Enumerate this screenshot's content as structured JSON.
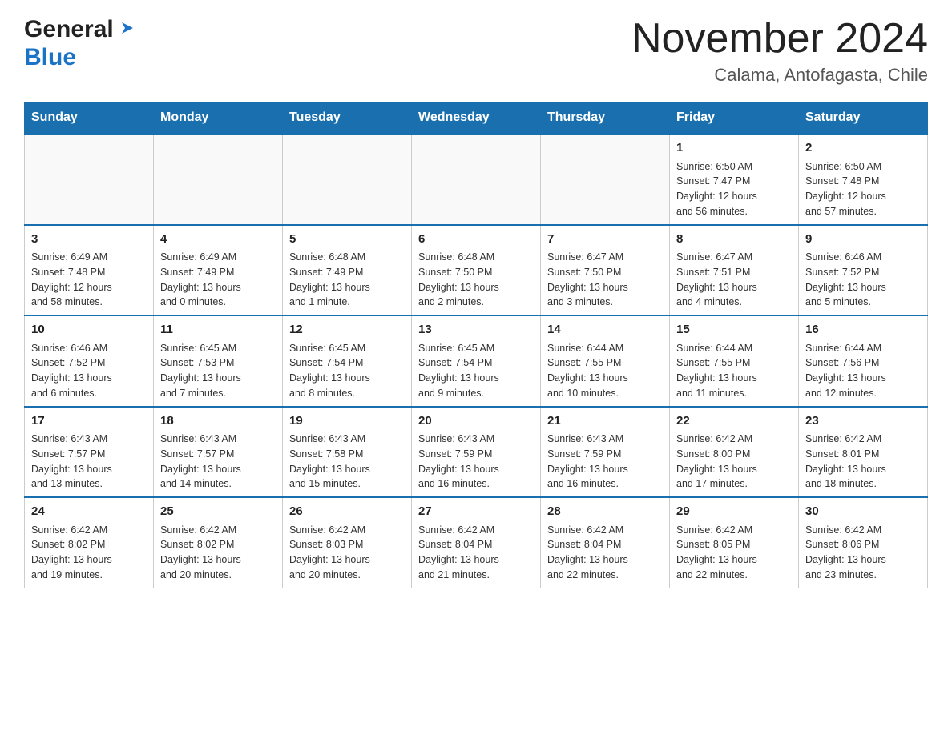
{
  "header": {
    "logo": {
      "general_text": "General",
      "blue_text": "Blue"
    },
    "month_title": "November 2024",
    "location": "Calama, Antofagasta, Chile"
  },
  "weekdays": [
    "Sunday",
    "Monday",
    "Tuesday",
    "Wednesday",
    "Thursday",
    "Friday",
    "Saturday"
  ],
  "weeks": [
    {
      "days": [
        {
          "number": "",
          "info": ""
        },
        {
          "number": "",
          "info": ""
        },
        {
          "number": "",
          "info": ""
        },
        {
          "number": "",
          "info": ""
        },
        {
          "number": "",
          "info": ""
        },
        {
          "number": "1",
          "info": "Sunrise: 6:50 AM\nSunset: 7:47 PM\nDaylight: 12 hours\nand 56 minutes."
        },
        {
          "number": "2",
          "info": "Sunrise: 6:50 AM\nSunset: 7:48 PM\nDaylight: 12 hours\nand 57 minutes."
        }
      ]
    },
    {
      "days": [
        {
          "number": "3",
          "info": "Sunrise: 6:49 AM\nSunset: 7:48 PM\nDaylight: 12 hours\nand 58 minutes."
        },
        {
          "number": "4",
          "info": "Sunrise: 6:49 AM\nSunset: 7:49 PM\nDaylight: 13 hours\nand 0 minutes."
        },
        {
          "number": "5",
          "info": "Sunrise: 6:48 AM\nSunset: 7:49 PM\nDaylight: 13 hours\nand 1 minute."
        },
        {
          "number": "6",
          "info": "Sunrise: 6:48 AM\nSunset: 7:50 PM\nDaylight: 13 hours\nand 2 minutes."
        },
        {
          "number": "7",
          "info": "Sunrise: 6:47 AM\nSunset: 7:50 PM\nDaylight: 13 hours\nand 3 minutes."
        },
        {
          "number": "8",
          "info": "Sunrise: 6:47 AM\nSunset: 7:51 PM\nDaylight: 13 hours\nand 4 minutes."
        },
        {
          "number": "9",
          "info": "Sunrise: 6:46 AM\nSunset: 7:52 PM\nDaylight: 13 hours\nand 5 minutes."
        }
      ]
    },
    {
      "days": [
        {
          "number": "10",
          "info": "Sunrise: 6:46 AM\nSunset: 7:52 PM\nDaylight: 13 hours\nand 6 minutes."
        },
        {
          "number": "11",
          "info": "Sunrise: 6:45 AM\nSunset: 7:53 PM\nDaylight: 13 hours\nand 7 minutes."
        },
        {
          "number": "12",
          "info": "Sunrise: 6:45 AM\nSunset: 7:54 PM\nDaylight: 13 hours\nand 8 minutes."
        },
        {
          "number": "13",
          "info": "Sunrise: 6:45 AM\nSunset: 7:54 PM\nDaylight: 13 hours\nand 9 minutes."
        },
        {
          "number": "14",
          "info": "Sunrise: 6:44 AM\nSunset: 7:55 PM\nDaylight: 13 hours\nand 10 minutes."
        },
        {
          "number": "15",
          "info": "Sunrise: 6:44 AM\nSunset: 7:55 PM\nDaylight: 13 hours\nand 11 minutes."
        },
        {
          "number": "16",
          "info": "Sunrise: 6:44 AM\nSunset: 7:56 PM\nDaylight: 13 hours\nand 12 minutes."
        }
      ]
    },
    {
      "days": [
        {
          "number": "17",
          "info": "Sunrise: 6:43 AM\nSunset: 7:57 PM\nDaylight: 13 hours\nand 13 minutes."
        },
        {
          "number": "18",
          "info": "Sunrise: 6:43 AM\nSunset: 7:57 PM\nDaylight: 13 hours\nand 14 minutes."
        },
        {
          "number": "19",
          "info": "Sunrise: 6:43 AM\nSunset: 7:58 PM\nDaylight: 13 hours\nand 15 minutes."
        },
        {
          "number": "20",
          "info": "Sunrise: 6:43 AM\nSunset: 7:59 PM\nDaylight: 13 hours\nand 16 minutes."
        },
        {
          "number": "21",
          "info": "Sunrise: 6:43 AM\nSunset: 7:59 PM\nDaylight: 13 hours\nand 16 minutes."
        },
        {
          "number": "22",
          "info": "Sunrise: 6:42 AM\nSunset: 8:00 PM\nDaylight: 13 hours\nand 17 minutes."
        },
        {
          "number": "23",
          "info": "Sunrise: 6:42 AM\nSunset: 8:01 PM\nDaylight: 13 hours\nand 18 minutes."
        }
      ]
    },
    {
      "days": [
        {
          "number": "24",
          "info": "Sunrise: 6:42 AM\nSunset: 8:02 PM\nDaylight: 13 hours\nand 19 minutes."
        },
        {
          "number": "25",
          "info": "Sunrise: 6:42 AM\nSunset: 8:02 PM\nDaylight: 13 hours\nand 20 minutes."
        },
        {
          "number": "26",
          "info": "Sunrise: 6:42 AM\nSunset: 8:03 PM\nDaylight: 13 hours\nand 20 minutes."
        },
        {
          "number": "27",
          "info": "Sunrise: 6:42 AM\nSunset: 8:04 PM\nDaylight: 13 hours\nand 21 minutes."
        },
        {
          "number": "28",
          "info": "Sunrise: 6:42 AM\nSunset: 8:04 PM\nDaylight: 13 hours\nand 22 minutes."
        },
        {
          "number": "29",
          "info": "Sunrise: 6:42 AM\nSunset: 8:05 PM\nDaylight: 13 hours\nand 22 minutes."
        },
        {
          "number": "30",
          "info": "Sunrise: 6:42 AM\nSunset: 8:06 PM\nDaylight: 13 hours\nand 23 minutes."
        }
      ]
    }
  ]
}
